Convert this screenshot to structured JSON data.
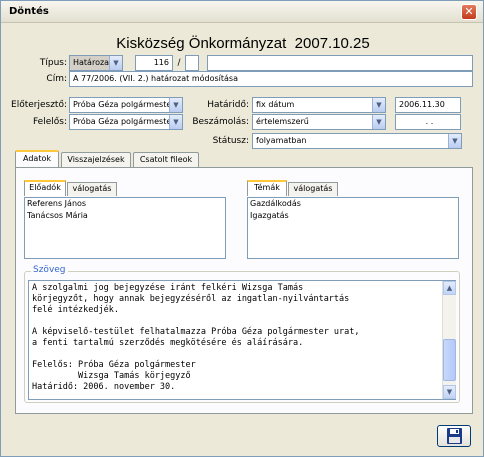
{
  "window": {
    "title": "Döntés",
    "close_glyph": "✕"
  },
  "heading": {
    "title": "Kisközség Önkormányzat",
    "date": "2007.10.25"
  },
  "form": {
    "tipus_label": "Típus:",
    "tipus_value": "Határozat",
    "number": "116",
    "slash": "/",
    "number_suffix": "",
    "extra": "",
    "cim_label": "Cím:",
    "cim_value": "A 77/2006. (VII. 2.) határozat módosítása",
    "eloterjeszto_label": "Előterjesztő:",
    "eloterjeszto_value": "Próba Géza polgármester",
    "felelos_label": "Felelős:",
    "felelos_value": "Próba Géza polgármester",
    "hatarido_label": "Határidő:",
    "hatarido_value": "fix dátum",
    "hatarido_date": "2006.11.30",
    "beszamolas_label": "Beszámolás:",
    "beszamolas_value": "értelemszerű",
    "beszamolas_date": ". .",
    "statusz_label": "Státusz:",
    "statusz_value": "folyamatban"
  },
  "tabs": [
    "Adatok",
    "Visszajelzések",
    "Csatolt fileok"
  ],
  "left_panel": {
    "tabs": [
      "Előadók",
      "válogatás"
    ],
    "items": [
      "Referens János",
      "Tanácsos Mária"
    ]
  },
  "right_panel": {
    "tabs": [
      "Témák",
      "válogatás"
    ],
    "items": [
      "Gazdálkodás",
      "Igazgatás"
    ]
  },
  "szoveg": {
    "legend": "Szöveg",
    "text": "A szolgalmi jog bejegyzése iránt felkéri Wizsga Tamás\nkörjegyzőt, hogy annak bejegyzéséről az ingatlan-nyilvántartás\nfelé intézkedjék.\n\nA képviselő-testület felhatalmazza Próba Géza polgármester urat,\na fenti tartalmú szerződés megkötésére és aláírására.\n\nFelelős: Próba Géza polgármester\n         Wizsga Tamás körjegyző\nHatáridő: 2006. november 30."
  },
  "icons": {
    "dropdown": "chevron-down-icon",
    "save": "floppy-disk-icon"
  },
  "colors": {
    "accent_tab": "#ffc83c",
    "legend": "#3366cc",
    "close": "#c23c1c"
  }
}
